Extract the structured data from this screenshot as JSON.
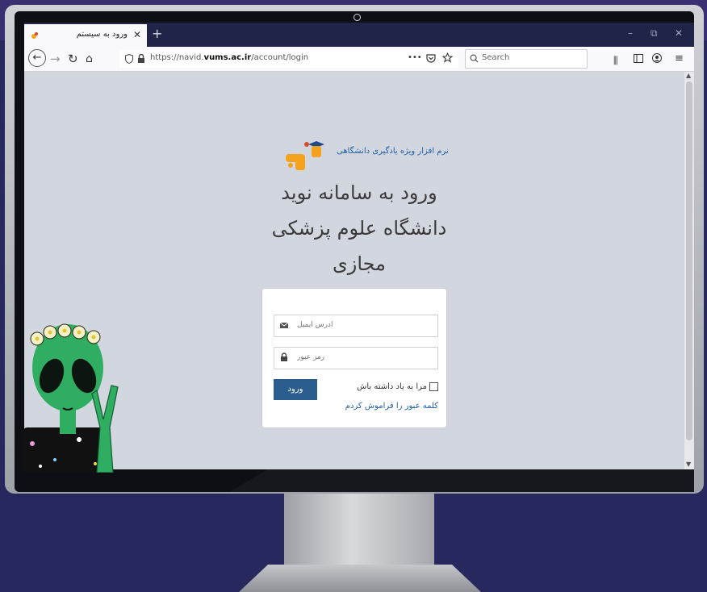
{
  "browser": {
    "tab_title": "ورود به سیستم",
    "tab_close": "✕",
    "new_tab": "+",
    "win_min": "–",
    "win_restore": "⧉",
    "win_close": "✕",
    "url_prefix": "https://navid.",
    "url_domain": "vums.ac.ir",
    "url_path": "/account/login",
    "search_placeholder": "Search",
    "page_actions": "•••"
  },
  "page": {
    "logo_tagline": "نرم افزار ویژه یادگیری دانشگاهی",
    "heading_line1": "ورود به سامانه نوید",
    "heading_line2": "دانشگاه علوم پزشکی",
    "heading_line3": "مجازی",
    "email_placeholder": "آدرس ایمیل",
    "password_placeholder": "رمز عبور",
    "login_button": "ورود",
    "remember_me": "مرا به یاد داشته باش",
    "forgot_password": "کلمه عبور را فراموش کردم"
  },
  "colors": {
    "background": "#27285e",
    "page_background": "#d2d6df",
    "button": "#2c5d8f",
    "link": "#1f5fa7",
    "logo_orange": "#f5a21c"
  },
  "icons": [
    "back-arrow-icon",
    "forward-arrow-icon",
    "reload-icon",
    "home-icon",
    "shield-icon",
    "lock-icon",
    "pocket-icon",
    "star-icon",
    "search-icon",
    "library-icon",
    "sidebar-icon",
    "account-icon",
    "menu-icon",
    "email-icon",
    "padlock-icon",
    "graduation-cap-icon",
    "alien-sticker"
  ]
}
